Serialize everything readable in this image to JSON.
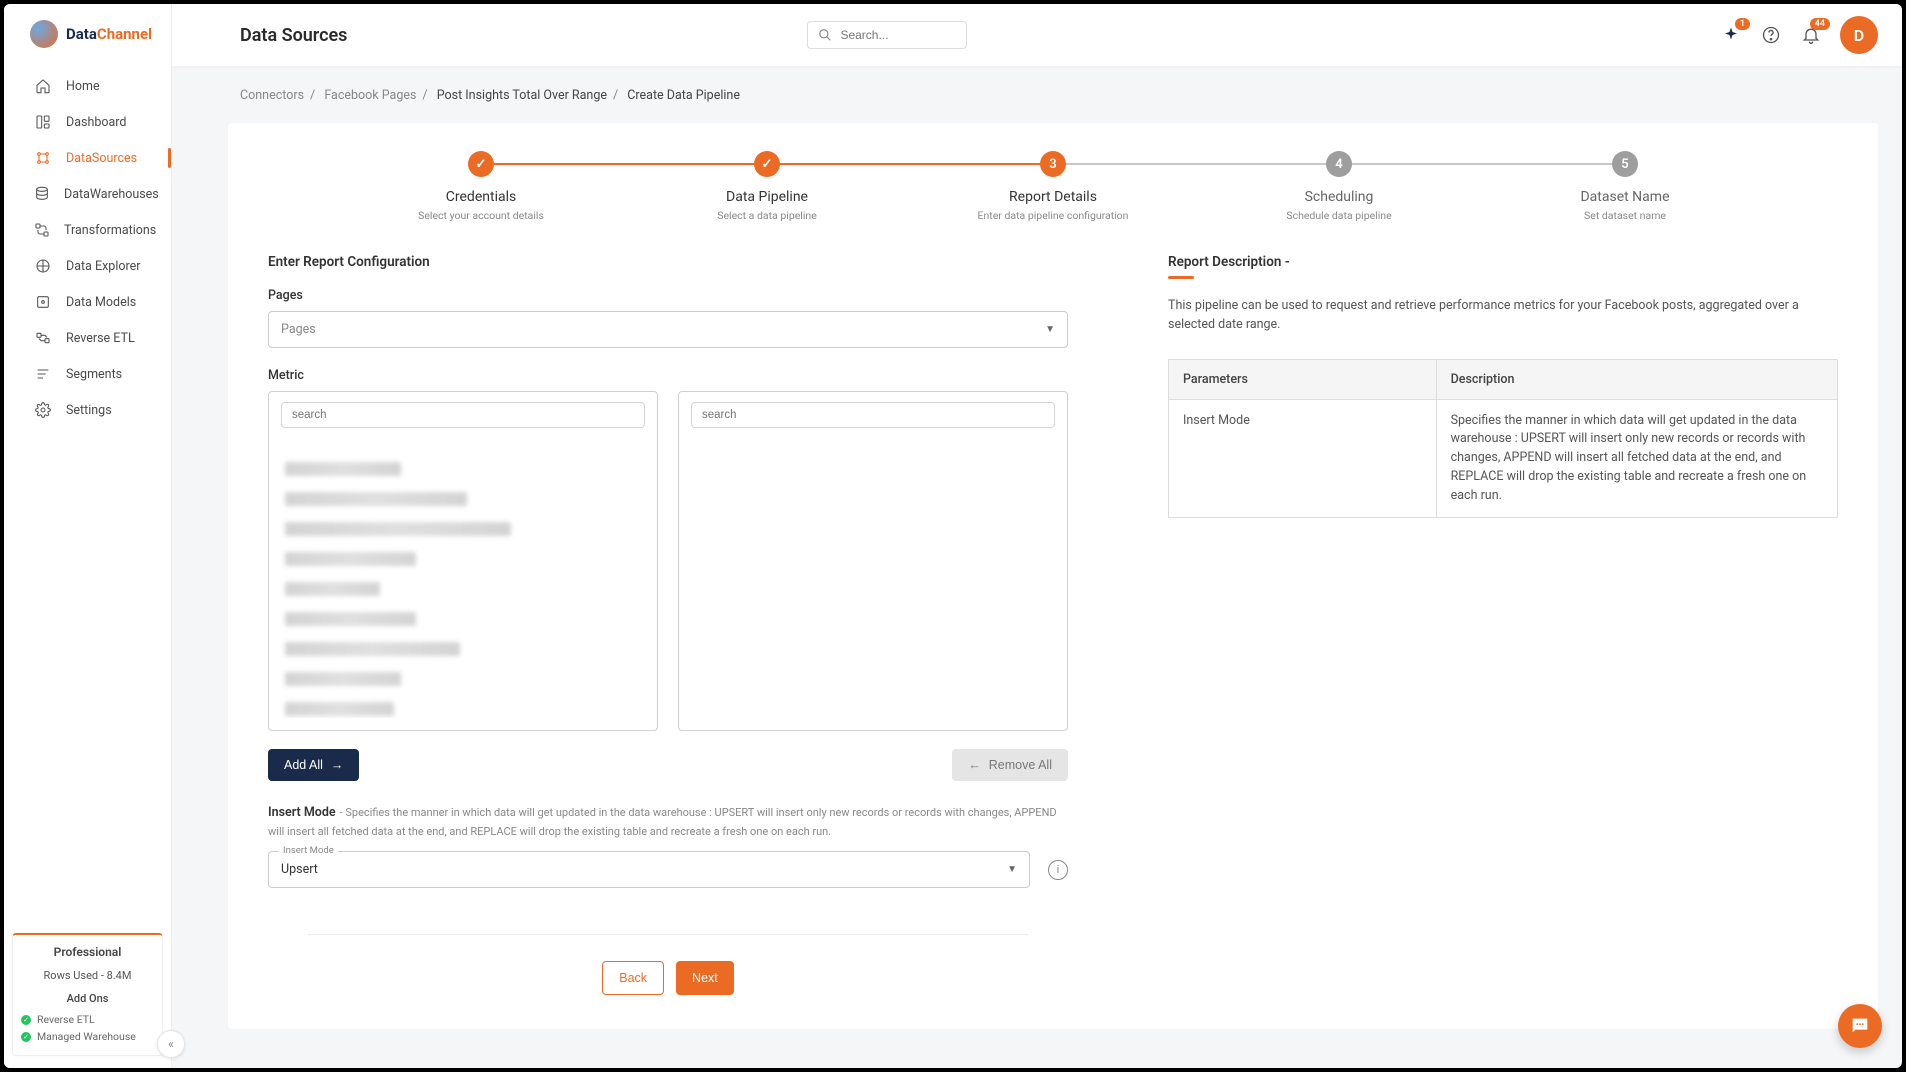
{
  "brand": {
    "name_a": "Data",
    "name_b": "Channel"
  },
  "nav": [
    {
      "label": "Home"
    },
    {
      "label": "Dashboard"
    },
    {
      "label": "DataSources"
    },
    {
      "label": "DataWarehouses"
    },
    {
      "label": "Transformations"
    },
    {
      "label": "Data Explorer"
    },
    {
      "label": "Data Models"
    },
    {
      "label": "Reverse ETL"
    },
    {
      "label": "Segments"
    },
    {
      "label": "Settings"
    }
  ],
  "plan": {
    "name": "Professional",
    "rows": "Rows Used - 8.4M",
    "addons_title": "Add Ons",
    "addon1": "Reverse ETL",
    "addon2": "Managed Warehouse"
  },
  "topbar": {
    "title": "Data Sources",
    "search_placeholder": "Search...",
    "notif_badge": "1",
    "bell_badge": "44",
    "avatar_letter": "D"
  },
  "breadcrumb": {
    "a": "Connectors",
    "b": "Facebook Pages",
    "c": "Post Insights Total Over Range",
    "d": "Create Data Pipeline"
  },
  "stepper": [
    {
      "title": "Credentials",
      "sub": "Select your account details"
    },
    {
      "title": "Data Pipeline",
      "sub": "Select a data pipeline"
    },
    {
      "title": "Report Details",
      "sub": "Enter data pipeline configuration",
      "num": "3"
    },
    {
      "title": "Scheduling",
      "sub": "Schedule data pipeline",
      "num": "4"
    },
    {
      "title": "Dataset Name",
      "sub": "Set dataset name",
      "num": "5"
    }
  ],
  "form": {
    "section_title": "Enter Report Configuration",
    "pages_label": "Pages",
    "pages_placeholder": "Pages",
    "metric_label": "Metric",
    "search_placeholder": "search",
    "add_all": "Add All",
    "remove_all": "Remove All",
    "insert_label": "Insert Mode",
    "insert_help": " - Specifies the manner in which data will get updated in the data warehouse : UPSERT will insert only new records or records with changes, APPEND will insert all fetched data at the end, and REPLACE will drop the existing table and recreate a fresh one on each run.",
    "insert_float": "Insert Mode",
    "insert_value": "Upsert",
    "back": "Back",
    "next": "Next"
  },
  "right": {
    "title": "Report Description -",
    "text": "This pipeline can be used to request and retrieve performance metrics for your Facebook posts, aggregated over a selected date range.",
    "th1": "Parameters",
    "th2": "Description",
    "row_param": "Insert Mode",
    "row_desc": "Specifies the manner in which data will get updated in the data warehouse : UPSERT will insert only new records or records with changes, APPEND will insert all fetched data at the end, and REPLACE will drop the existing table and recreate a fresh one on each run."
  }
}
